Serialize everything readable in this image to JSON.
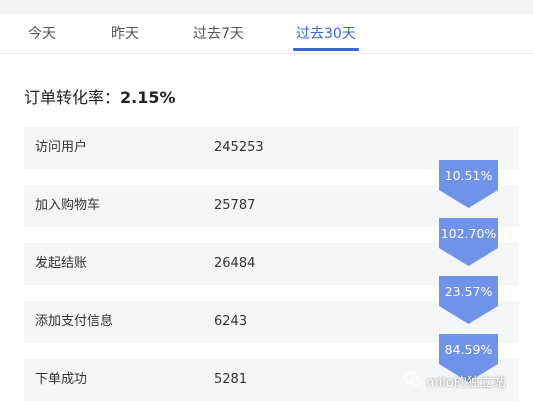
{
  "tabs": [
    {
      "label": "今天"
    },
    {
      "label": "昨天"
    },
    {
      "label": "过去7天"
    },
    {
      "label": "过去30天",
      "active": true
    }
  ],
  "summary": {
    "label": "订单转化率：",
    "rate": "2.15%"
  },
  "funnel": [
    {
      "label": "访问用户",
      "value": "245253"
    },
    {
      "label": "加入购物车",
      "value": "25787"
    },
    {
      "label": "发起结账",
      "value": "26484"
    },
    {
      "label": "添加支付信息",
      "value": "6243"
    },
    {
      "label": "下单成功",
      "value": "5281"
    }
  ],
  "step_rates": [
    "10.51%",
    "102.70%",
    "23.57%",
    "84.59%"
  ],
  "watermark": {
    "text": "milo的独立站",
    "icon": "wechat-icon"
  },
  "colors": {
    "accent": "#3a66d8",
    "badge": "#6f93ea",
    "row_bg": "#f5f6f8"
  }
}
